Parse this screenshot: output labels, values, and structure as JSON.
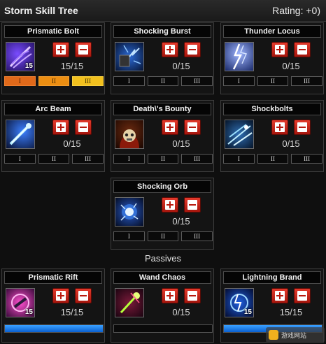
{
  "header": {
    "title": "Storm Skill Tree",
    "rating": "Rating: +0)"
  },
  "skills": [
    {
      "name": "Prismatic Bolt",
      "icon": "prismatic-bolt-icon",
      "rank": "15",
      "count": "15/15",
      "tiers": [
        "I",
        "II",
        "III"
      ],
      "tiers_active": true
    },
    {
      "name": "Shocking Burst",
      "icon": "shocking-burst-icon",
      "rank": "",
      "count": "0/15",
      "tiers": [
        "I",
        "II",
        "III"
      ],
      "tiers_active": false
    },
    {
      "name": "Thunder Locus",
      "icon": "thunder-locus-icon",
      "rank": "",
      "count": "0/15",
      "tiers": [
        "I",
        "II",
        "III"
      ],
      "tiers_active": false
    },
    {
      "name": "Arc Beam",
      "icon": "arc-beam-icon",
      "rank": "",
      "count": "0/15",
      "tiers": [
        "I",
        "II",
        "III"
      ],
      "tiers_active": false
    },
    {
      "name": "Death\\'s Bounty",
      "icon": "deaths-bounty-icon",
      "rank": "",
      "count": "0/15",
      "tiers": [
        "I",
        "II",
        "III"
      ],
      "tiers_active": false
    },
    {
      "name": "Shockbolts",
      "icon": "shockbolts-icon",
      "rank": "",
      "count": "0/15",
      "tiers": [
        "I",
        "II",
        "III"
      ],
      "tiers_active": false
    },
    {
      "name": "Shocking Orb",
      "icon": "shocking-orb-icon",
      "rank": "",
      "count": "0/15",
      "tiers": [
        "I",
        "II",
        "III"
      ],
      "tiers_active": false
    }
  ],
  "passives_label": "Passives",
  "passives": [
    {
      "name": "Prismatic Rift",
      "icon": "prismatic-rift-icon",
      "rank": "15",
      "count": "15/15",
      "progress": 1.0
    },
    {
      "name": "Wand Chaos",
      "icon": "wand-chaos-icon",
      "rank": "",
      "count": "0/15",
      "progress": 0.0
    },
    {
      "name": "Lightning Brand",
      "icon": "lightning-brand-icon",
      "rank": "15",
      "count": "15/15",
      "progress": 1.0
    }
  ],
  "colors": {
    "accent_red": "#d42a1c",
    "progress_blue": "#1f7fe8",
    "tier_orange": "#ec8e12",
    "tier_yellow": "#f2c01e"
  }
}
